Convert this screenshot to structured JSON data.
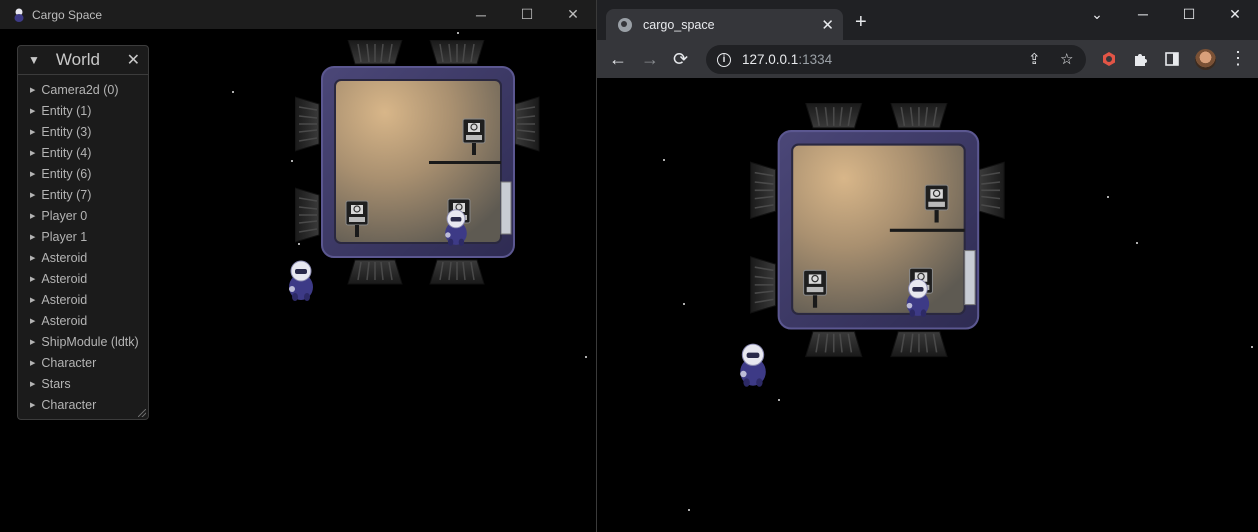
{
  "left_window": {
    "title": "Cargo Space",
    "controls": {
      "minimize": "─",
      "maximize": "☐",
      "close": "✕"
    },
    "inspector": {
      "title": "World",
      "collapse_glyph": "▼",
      "close_glyph": "✕",
      "items": [
        "Camera2d (0)",
        "Entity (1)",
        "Entity (3)",
        "Entity (4)",
        "Entity (6)",
        "Entity (7)",
        "Player 0",
        "Player 1",
        "Asteroid",
        "Asteroid",
        "Asteroid",
        "Asteroid",
        "ShipModule (ldtk)",
        "Character",
        "Stars",
        "Character"
      ]
    }
  },
  "browser": {
    "tab": {
      "title": "cargo_space",
      "close_glyph": "✕"
    },
    "new_tab_glyph": "+",
    "url": {
      "host": "127.0.0.1",
      "port": ":1334"
    },
    "controls": {
      "tab_search": "⌄",
      "minimize": "─",
      "maximize": "☐",
      "close": "✕"
    },
    "nav": {
      "back": "←",
      "forward": "→",
      "reload": "⟳"
    }
  },
  "colors": {
    "hull": "#3d3a66",
    "floor_light": "#c9a57c",
    "floor_dark": "#6e6a60",
    "thruster": "#2b2b2b",
    "space": "#000000"
  },
  "icons": [
    "app-icon",
    "globe-icon",
    "info-icon",
    "share-icon",
    "star-icon",
    "extension-icon",
    "puzzle-icon",
    "sidepanel-icon",
    "profile-avatar",
    "menu-icon"
  ]
}
